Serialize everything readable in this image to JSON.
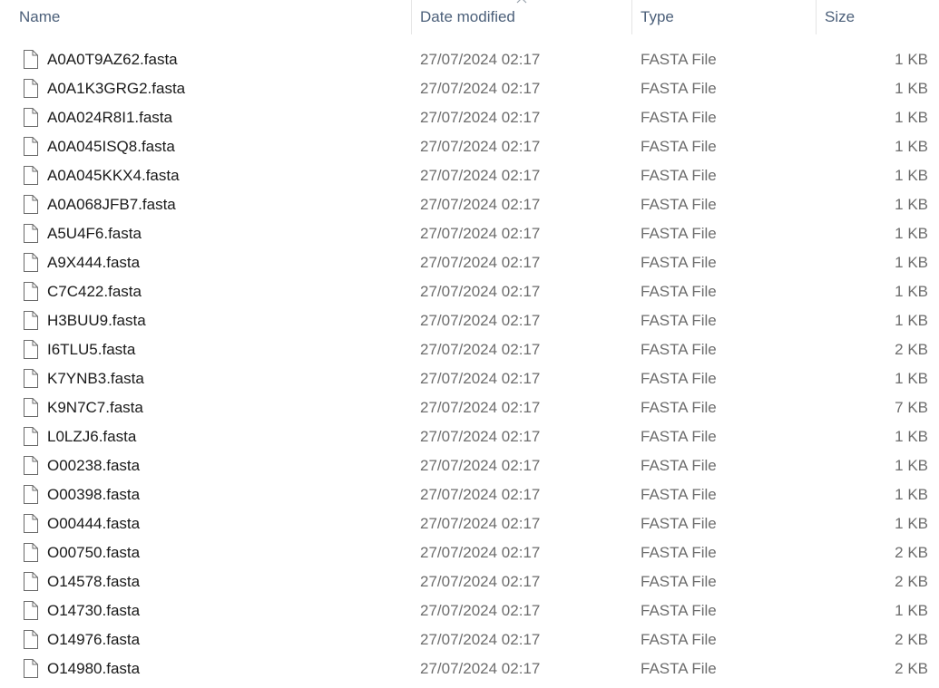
{
  "columns": {
    "name": "Name",
    "date": "Date modified",
    "type": "Type",
    "size": "Size",
    "sort_icon": "chevron-up-icon"
  },
  "file_icon": "document-icon",
  "colors": {
    "header_text": "#4c607a",
    "name_text": "#1a1a1a",
    "meta_text": "#6d6d6d"
  },
  "files": [
    {
      "name": "A0A0T9AZ62.fasta",
      "date": "27/07/2024 02:17",
      "type": "FASTA File",
      "size": "1 KB"
    },
    {
      "name": "A0A1K3GRG2.fasta",
      "date": "27/07/2024 02:17",
      "type": "FASTA File",
      "size": "1 KB"
    },
    {
      "name": "A0A024R8I1.fasta",
      "date": "27/07/2024 02:17",
      "type": "FASTA File",
      "size": "1 KB"
    },
    {
      "name": "A0A045ISQ8.fasta",
      "date": "27/07/2024 02:17",
      "type": "FASTA File",
      "size": "1 KB"
    },
    {
      "name": "A0A045KKX4.fasta",
      "date": "27/07/2024 02:17",
      "type": "FASTA File",
      "size": "1 KB"
    },
    {
      "name": "A0A068JFB7.fasta",
      "date": "27/07/2024 02:17",
      "type": "FASTA File",
      "size": "1 KB"
    },
    {
      "name": "A5U4F6.fasta",
      "date": "27/07/2024 02:17",
      "type": "FASTA File",
      "size": "1 KB"
    },
    {
      "name": "A9X444.fasta",
      "date": "27/07/2024 02:17",
      "type": "FASTA File",
      "size": "1 KB"
    },
    {
      "name": "C7C422.fasta",
      "date": "27/07/2024 02:17",
      "type": "FASTA File",
      "size": "1 KB"
    },
    {
      "name": "H3BUU9.fasta",
      "date": "27/07/2024 02:17",
      "type": "FASTA File",
      "size": "1 KB"
    },
    {
      "name": "I6TLU5.fasta",
      "date": "27/07/2024 02:17",
      "type": "FASTA File",
      "size": "2 KB"
    },
    {
      "name": "K7YNB3.fasta",
      "date": "27/07/2024 02:17",
      "type": "FASTA File",
      "size": "1 KB"
    },
    {
      "name": "K9N7C7.fasta",
      "date": "27/07/2024 02:17",
      "type": "FASTA File",
      "size": "7 KB"
    },
    {
      "name": "L0LZJ6.fasta",
      "date": "27/07/2024 02:17",
      "type": "FASTA File",
      "size": "1 KB"
    },
    {
      "name": "O00238.fasta",
      "date": "27/07/2024 02:17",
      "type": "FASTA File",
      "size": "1 KB"
    },
    {
      "name": "O00398.fasta",
      "date": "27/07/2024 02:17",
      "type": "FASTA File",
      "size": "1 KB"
    },
    {
      "name": "O00444.fasta",
      "date": "27/07/2024 02:17",
      "type": "FASTA File",
      "size": "1 KB"
    },
    {
      "name": "O00750.fasta",
      "date": "27/07/2024 02:17",
      "type": "FASTA File",
      "size": "2 KB"
    },
    {
      "name": "O14578.fasta",
      "date": "27/07/2024 02:17",
      "type": "FASTA File",
      "size": "2 KB"
    },
    {
      "name": "O14730.fasta",
      "date": "27/07/2024 02:17",
      "type": "FASTA File",
      "size": "1 KB"
    },
    {
      "name": "O14976.fasta",
      "date": "27/07/2024 02:17",
      "type": "FASTA File",
      "size": "2 KB"
    },
    {
      "name": "O14980.fasta",
      "date": "27/07/2024 02:17",
      "type": "FASTA File",
      "size": "2 KB"
    }
  ]
}
